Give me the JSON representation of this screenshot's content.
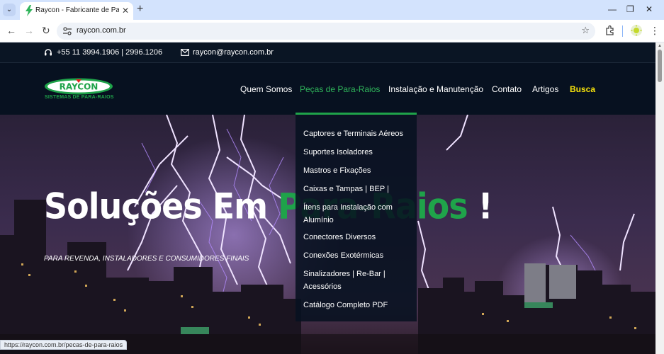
{
  "browser": {
    "tab_title": "Raycon - Fabricante de Para-Raios",
    "url": "raycon.com.br",
    "status_url": "https://raycon.com.br/pecas-de-para-raios"
  },
  "topbar": {
    "phone": "+55 11 3994.1906 | 2996.1206",
    "email": "raycon@raycon.com.br"
  },
  "logo": {
    "name": "RAYCON",
    "tagline": "SISTEMAS DE PARA-RAIOS"
  },
  "nav": {
    "quem_somos": "Quem Somos",
    "pecas": "Peças de Para-Raios",
    "instalacao": "Instalação e Manutenção",
    "contato": "Contato",
    "artigos": "Artigos",
    "busca": "Busca"
  },
  "hero": {
    "title_pre": "Soluções Em ",
    "title_highlight": "Para-Raios",
    "title_post": " !",
    "subtitle": "PARA REVENDA, INSTALADORES E CONSUMIDORES FINAIS"
  },
  "dropdown": {
    "items": [
      "Captores e Terminais Aéreos",
      "Suportes Isoladores",
      "Mastros e Fixações",
      "Caixas e Tampas | BEP |",
      "Ítens para Instalação com Alumínio",
      "Conectores Diversos",
      "Conexões Exotérmicas",
      "Sinalizadores | Re-Bar | Acessórios",
      "Catálogo Completo PDF"
    ]
  },
  "colors": {
    "brand_green": "#1fa34a",
    "nav_highlight_yellow": "#f5e10b",
    "dark_navy": "#071120"
  }
}
